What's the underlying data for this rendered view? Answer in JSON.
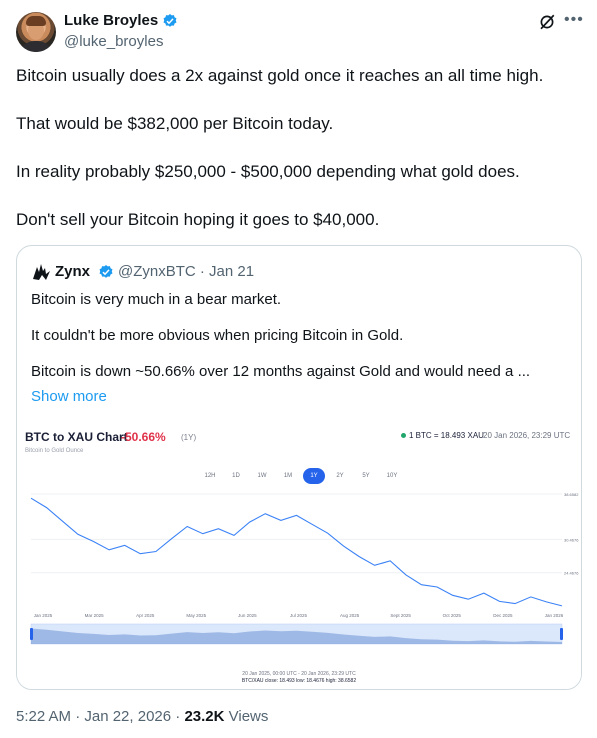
{
  "author": {
    "name": "Luke Broyles",
    "handle": "@luke_broyles"
  },
  "tweet": {
    "paragraphs": [
      "Bitcoin usually does a 2x against gold once it reaches an all time high.",
      "That would be $382,000 per Bitcoin today.",
      "In reality probably $250,000 - $500,000 depending what gold does.",
      "Don't sell your Bitcoin hoping it goes to $40,000."
    ]
  },
  "quote": {
    "name": "Zynx",
    "meta": "@ZynxBTC · Jan 21",
    "paragraphs": [
      "Bitcoin is very much in a bear market.",
      "It couldn't be more obvious when pricing Bitcoin in Gold.",
      "Bitcoin is down ~50.66% over 12 months against Gold and would need a ..."
    ],
    "show_more": "Show more"
  },
  "chart_ui": {
    "title": "BTC to XAU Chart",
    "change": "-50.66%",
    "range": "(1Y)",
    "subtitle": "Bitcoin to Gold Ounce",
    "price": "1 BTC = 18.493 XAU",
    "date": "20 Jan 2026, 23:29 UTC",
    "tabs": [
      "12H",
      "1D",
      "1W",
      "1M",
      "1Y",
      "2Y",
      "5Y",
      "10Y"
    ],
    "active_tab": "1Y",
    "footer_line1": "20 Jan 2025, 00:00 UTC - 20 Jan 2026, 23:29 UTC",
    "footer_line2": "BTC/XAU close: 18.493 low: 18.4676 high: 38.6582",
    "line_color": "#3b82f6"
  },
  "chart_data": {
    "type": "line",
    "x": [
      "Jan 2025",
      "Mar 2025",
      "Apr 2025",
      "May 2025",
      "Jun 2025",
      "Jul 2025",
      "Aug 2025",
      "Sept 2025",
      "Oct 2025",
      "Dec 2025",
      "Jan 2026"
    ],
    "y_ticks": [
      "38.6582",
      "30.4676",
      "24.4676"
    ],
    "series": [
      {
        "values": [
          37.9,
          36.2,
          33.8,
          31.4,
          30.1,
          28.6,
          29.4,
          27.9,
          28.3,
          30.6,
          32.8,
          31.5,
          32.4,
          31.2,
          33.6,
          35.1,
          33.9,
          34.8,
          33.2,
          31.6,
          29.3,
          27.4,
          25.8,
          26.6,
          24.1,
          22.3,
          21.9,
          20.4,
          19.7,
          20.8,
          19.3,
          18.9,
          20.1,
          19.2,
          18.49
        ]
      }
    ],
    "ylim": [
      18.4676,
      38.6582
    ]
  },
  "footer": {
    "time": "5:22 AM · Jan 22, 2026 · ",
    "views_count": "23.2K",
    "views_label": " Views"
  }
}
